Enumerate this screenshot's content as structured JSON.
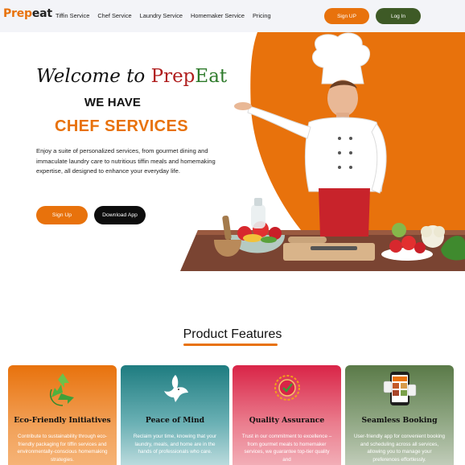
{
  "nav": {
    "logo_a": "Prep",
    "logo_b": "eat",
    "links": [
      "Tiffin Service",
      "Chef Service",
      "Laundry Service",
      "Homemaker Service",
      "Pricing"
    ],
    "signup_label": "Sign UP",
    "login_label": "Log In"
  },
  "hero": {
    "title_prefix": "Welcome to ",
    "brand_a": "Prep",
    "brand_b": "Eat",
    "subtitle": "WE HAVE",
    "service": "CHEF SERVICES",
    "description": "Enjoy a suite of personalized services, from gourmet dining and immaculate laundry care to nutritious tiffin meals and homemaking expertise, all designed to enhance your everyday life.",
    "signup_label": "Sign Up",
    "download_label": "Download App"
  },
  "features": {
    "heading": "Product Features",
    "cards": [
      {
        "icon": "recycle-icon",
        "title": "Eco-Friendly Initiatives",
        "text": "Contribute to sustainability through eco-friendly packaging for tiffin services and environmentally-conscious homemaking strategies."
      },
      {
        "icon": "dove-icon",
        "title": "Peace of Mind",
        "text": "Reclaim your time, knowing that your laundry, meals, and home are in the hands of professionals who care."
      },
      {
        "icon": "quality-badge-icon",
        "title": "Quality Assurance",
        "text": "Trust in our commitment to excellence – from gourmet meals to homemaker services, we guarantee top-tier quality and"
      },
      {
        "icon": "mobile-app-icon",
        "title": "Seamless Booking",
        "text": "User-friendly app for convenient booking and scheduling across all services, allowing you to manage your preferences effortlessly."
      }
    ]
  },
  "colors": {
    "accent": "#e8720c",
    "login": "#3e5a26",
    "brand_red": "#b01e1e",
    "brand_green": "#2d7a2a"
  }
}
